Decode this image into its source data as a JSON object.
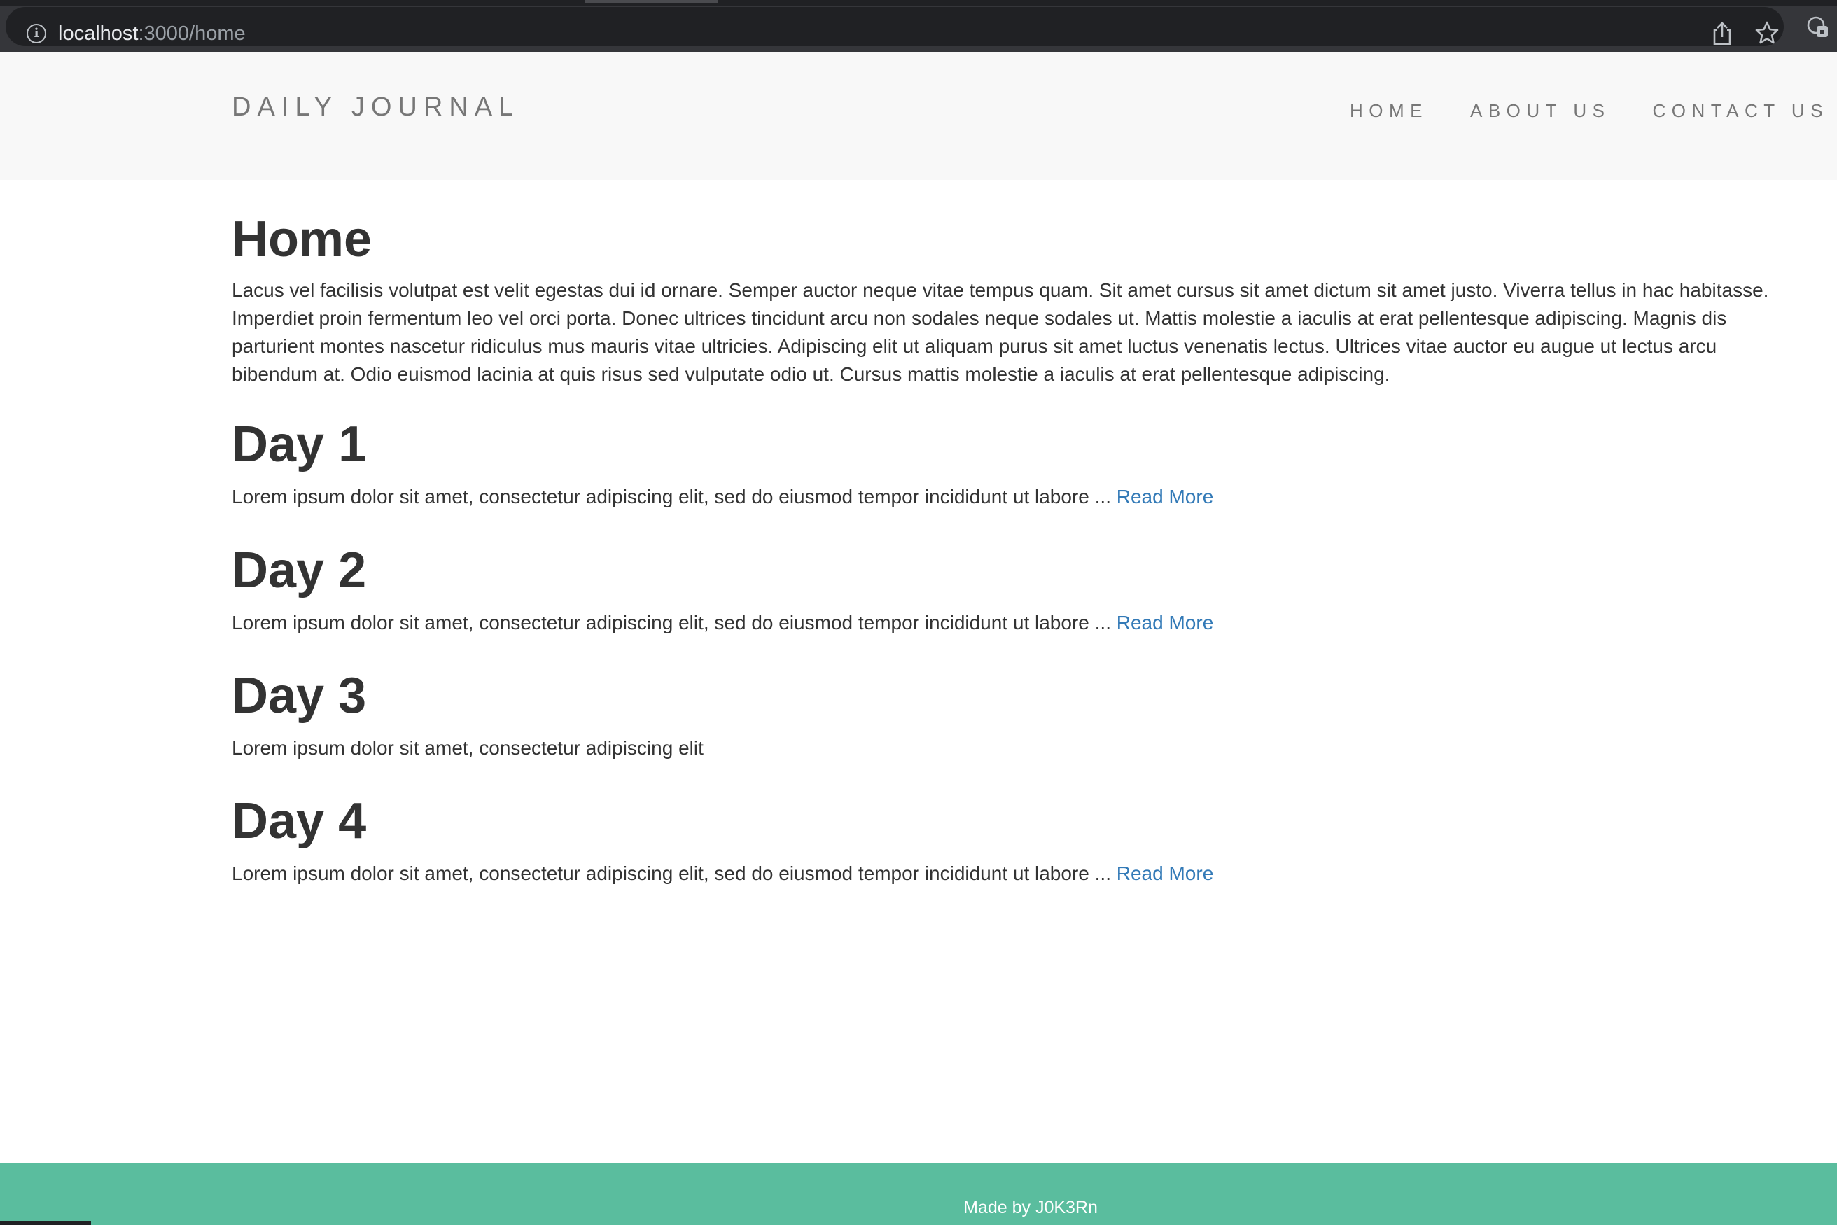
{
  "browser": {
    "url_host": "localhost",
    "url_path": ":3000/home"
  },
  "header": {
    "brand": "DAILY JOURNAL",
    "nav": [
      {
        "label": "HOME"
      },
      {
        "label": "ABOUT US"
      },
      {
        "label": "CONTACT US"
      }
    ]
  },
  "main": {
    "title": "Home",
    "intro": "Lacus vel facilisis volutpat est velit egestas dui id ornare. Semper auctor neque vitae tempus quam. Sit amet cursus sit amet dictum sit amet justo. Viverra tellus in hac habitasse. Imperdiet proin fermentum leo vel orci porta. Donec ultrices tincidunt arcu non sodales neque sodales ut. Mattis molestie a iaculis at erat pellentesque adipiscing. Magnis dis parturient montes nascetur ridiculus mus mauris vitae ultricies. Adipiscing elit ut aliquam purus sit amet luctus venenatis lectus. Ultrices vitae auctor eu augue ut lectus arcu bibendum at. Odio euismod lacinia at quis risus sed vulputate odio ut. Cursus mattis molestie a iaculis at erat pellentesque adipiscing.",
    "posts": [
      {
        "title": "Day 1",
        "excerpt": "Lorem ipsum dolor sit amet, consectetur adipiscing elit, sed do eiusmod tempor incididunt ut labore ... ",
        "link": "Read More"
      },
      {
        "title": "Day 2",
        "excerpt": "Lorem ipsum dolor sit amet, consectetur adipiscing elit, sed do eiusmod tempor incididunt ut labore ... ",
        "link": "Read More"
      },
      {
        "title": "Day 3",
        "excerpt": "Lorem ipsum dolor sit amet, consectetur adipiscing elit",
        "link": ""
      },
      {
        "title": "Day 4",
        "excerpt": "Lorem ipsum dolor sit amet, consectetur adipiscing elit, sed do eiusmod tempor incididunt ut labore ... ",
        "link": "Read More"
      }
    ]
  },
  "footer": {
    "text": "Made by J0K3Rn"
  },
  "colors": {
    "footer_bg": "#5abd9e",
    "link": "#337ab7",
    "header_bg": "#f8f8f8"
  }
}
